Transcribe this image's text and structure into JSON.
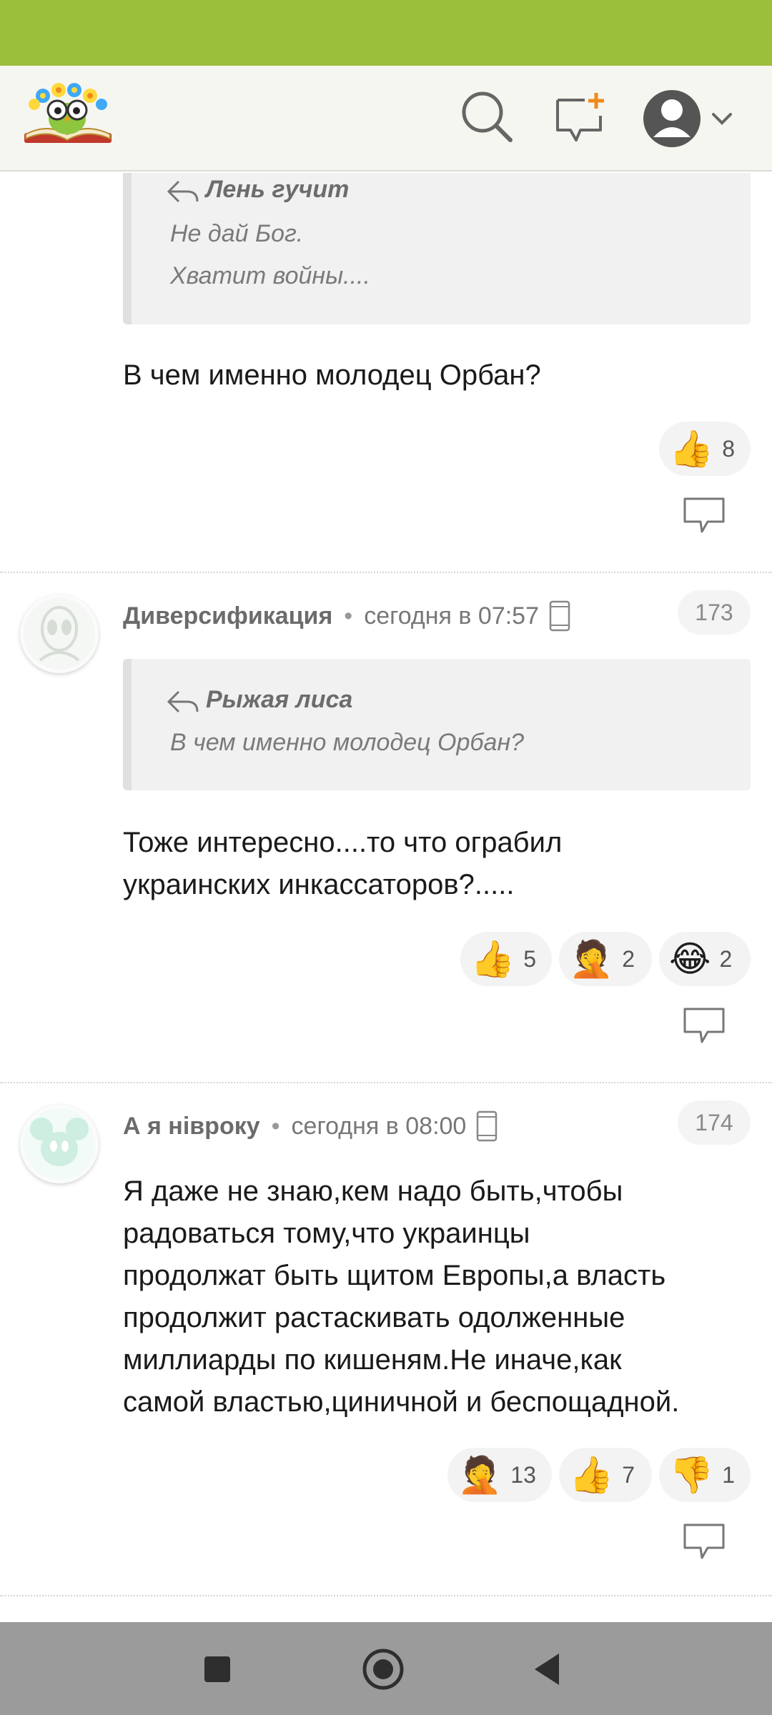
{
  "colors": {
    "status_bar": "#9cbf3b",
    "header_bg": "#f6f6f1",
    "navbar": "#9b9b9b",
    "accent": "#f08a1c"
  },
  "header": {
    "logo": "owl-reading-book-logo",
    "icons": [
      "search-icon",
      "new-message-icon",
      "profile-avatar-icon",
      "chevron-down-icon"
    ]
  },
  "comments": [
    {
      "quote": {
        "author": "Лень гучит",
        "lines": [
          "Не дай Бог.",
          "Хватит войны...."
        ]
      },
      "text": "В чем именно молодец Орбан?",
      "reactions": [
        {
          "emoji": "👍",
          "icon": "thumbs-up",
          "count": "8"
        }
      ]
    },
    {
      "author": "Диверсификация",
      "time": "сегодня в 07:57",
      "device": "phone-icon",
      "number": "173",
      "quote": {
        "author": "Рыжая лиса",
        "lines": [
          "В чем именно молодец Орбан?"
        ]
      },
      "text_lines": [
        "Тоже интересно....то что ограбил",
        "украинских инкассаторов?....."
      ],
      "reactions": [
        {
          "emoji": "👍",
          "icon": "thumbs-up",
          "count": "5"
        },
        {
          "emoji": "🤦",
          "icon": "facepalm",
          "count": "2"
        },
        {
          "emoji": "😂",
          "icon": "tears-of-joy",
          "count": "2"
        }
      ]
    },
    {
      "author": "А я нівроку",
      "time": "сегодня в 08:00",
      "device": "phone-icon",
      "number": "174",
      "text_lines": [
        "Я даже не знаю,кем надо быть,чтобы",
        "радоваться тому,что украинцы",
        "продолжат быть щитом Европы,а власть",
        "продолжит растаскивать одолженные",
        "миллиарды по кишеням.Не иначе,как",
        "самой властью,циничной и беспощадной."
      ],
      "reactions": [
        {
          "emoji": "🤦",
          "icon": "facepalm",
          "count": "13"
        },
        {
          "emoji": "👍",
          "icon": "thumbs-up",
          "count": "7"
        },
        {
          "emoji": "👎",
          "icon": "thumbs-down",
          "count": "1"
        }
      ]
    }
  ],
  "navbar": {
    "icons": [
      "recents-square-icon",
      "home-circle-icon",
      "back-triangle-icon"
    ]
  }
}
